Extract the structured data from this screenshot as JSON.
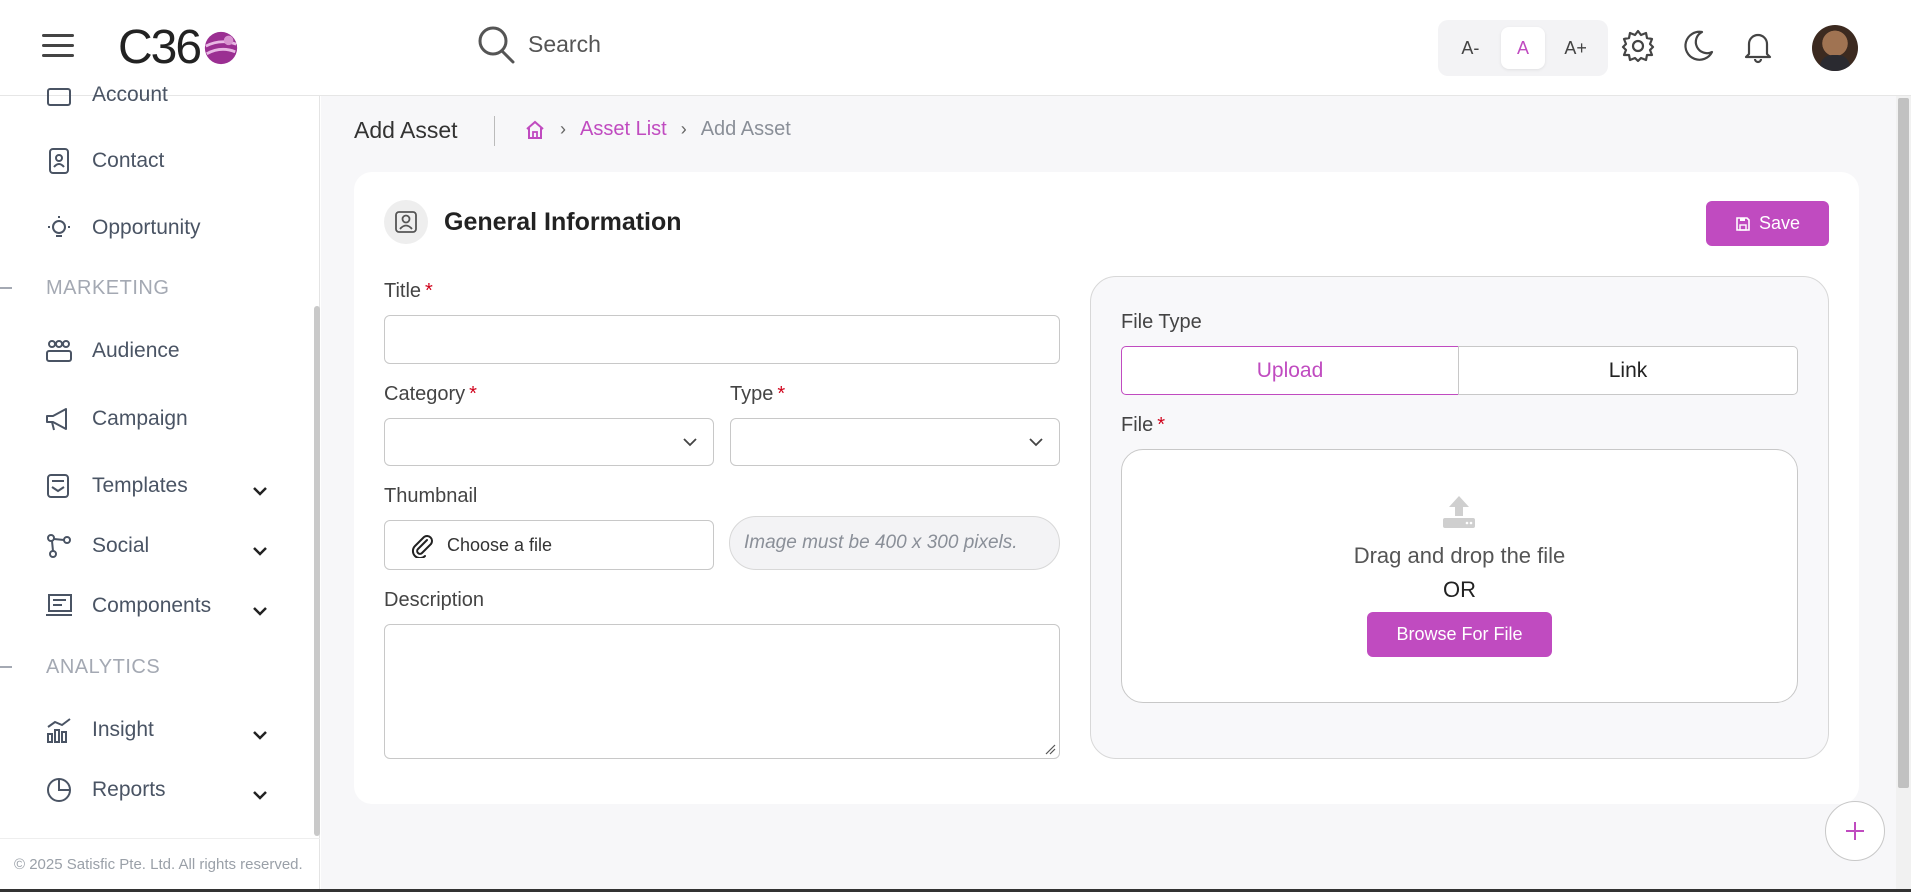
{
  "header": {
    "logo_text": "C36",
    "search_placeholder": "Search",
    "font_controls": [
      "A-",
      "A",
      "A+"
    ],
    "active_font": "A",
    "icons": [
      "menu-icon",
      "search-icon",
      "gear-icon",
      "moon-icon",
      "bell-icon"
    ]
  },
  "sidebar": {
    "items_top": [
      {
        "label": "Account",
        "icon": "account-icon"
      },
      {
        "label": "Contact",
        "icon": "contact-icon"
      },
      {
        "label": "Opportunity",
        "icon": "lightbulb-icon"
      }
    ],
    "section_marketing": "MARKETING",
    "marketing_items": [
      {
        "label": "Audience",
        "icon": "audience-icon"
      },
      {
        "label": "Campaign",
        "icon": "megaphone-icon"
      },
      {
        "label": "Templates",
        "icon": "template-icon"
      },
      {
        "label": "Social",
        "icon": "share-icon"
      },
      {
        "label": "Components",
        "icon": "components-icon"
      }
    ],
    "section_analytics": "ANALYTICS",
    "analytics_items": [
      {
        "label": "Insight",
        "icon": "chart-icon"
      },
      {
        "label": "Reports",
        "icon": "pie-icon"
      }
    ],
    "copyright": "© 2025 Satisfic Pte. Ltd. All rights reserved."
  },
  "page": {
    "title": "Add Asset",
    "breadcrumb": {
      "link": "Asset List",
      "current": "Add Asset"
    }
  },
  "form": {
    "section_title": "General Information",
    "save_label": "Save",
    "title_label": "Title",
    "category_label": "Category",
    "type_label": "Type",
    "thumbnail_label": "Thumbnail",
    "choose_file_label": "Choose a file",
    "thumbnail_hint": "Image must be 400 x 300 pixels.",
    "description_label": "Description",
    "required_mark": "*"
  },
  "file_panel": {
    "file_type_label": "File Type",
    "options": [
      "Upload",
      "Link"
    ],
    "selected": "Upload",
    "file_label": "File",
    "drag_text": "Drag and drop the file",
    "or_text": "OR",
    "browse_label": "Browse For File"
  },
  "colors": {
    "accent": "#c04bc0",
    "required": "#d0021b"
  }
}
